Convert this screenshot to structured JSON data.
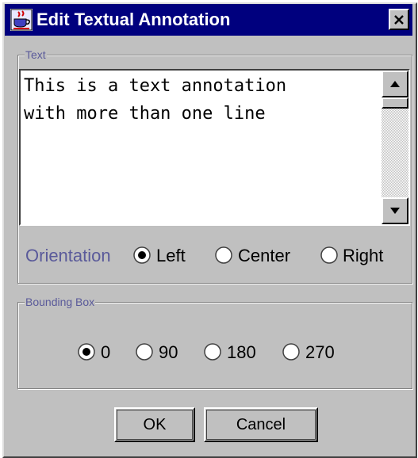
{
  "window": {
    "title": "Edit Textual Annotation",
    "close_label": "✕"
  },
  "text_group": {
    "legend": "Text",
    "content": "This is a text annotation\nwith more than one line",
    "orientation_label": "Orientation",
    "orientation_options": [
      "Left",
      "Center",
      "Right"
    ],
    "orientation_selected": "Left"
  },
  "bbox_group": {
    "legend": "Bounding Box",
    "options": [
      "0",
      "90",
      "180",
      "270"
    ],
    "selected": "0"
  },
  "buttons": {
    "ok": "OK",
    "cancel": "Cancel"
  },
  "colors": {
    "titlebar": "#00007e",
    "face": "#c0c0c0",
    "group_label": "#5a5a9a"
  }
}
